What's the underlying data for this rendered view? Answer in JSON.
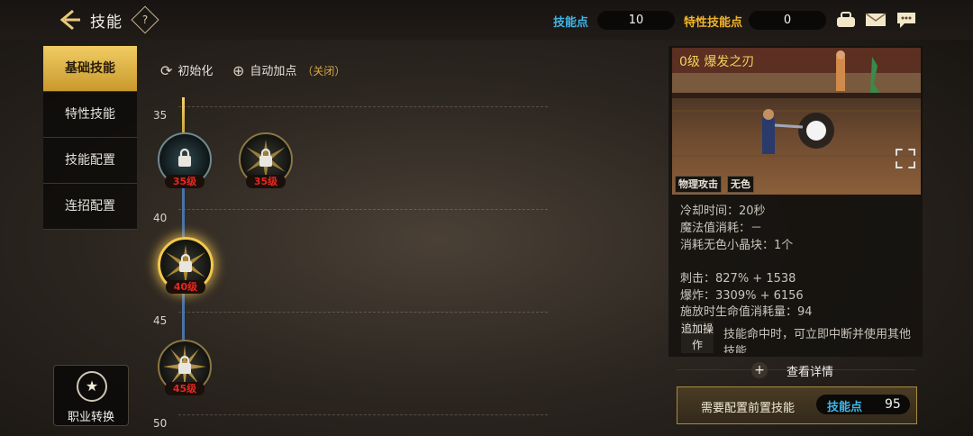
{
  "header": {
    "title": "技能",
    "help_icon": "?",
    "skill_points_label": "技能点",
    "skill_points_value": "10",
    "trait_points_label": "特性技能点",
    "trait_points_value": "0",
    "colors": {
      "skill_label": "#3fb6e8",
      "trait_label": "#f0b429"
    }
  },
  "sidebar": {
    "items": [
      {
        "label": "基础技能",
        "active": true
      },
      {
        "label": "特性技能",
        "active": false
      },
      {
        "label": "技能配置",
        "active": false
      },
      {
        "label": "连招配置",
        "active": false
      }
    ],
    "job_change_label": "职业转换"
  },
  "toolbar": {
    "reset_label": "初始化",
    "auto_label": "自动加点",
    "auto_state": "（关闭）"
  },
  "tree": {
    "levels": [
      "35",
      "40",
      "45",
      "50"
    ],
    "skills": [
      {
        "badge": "35级"
      },
      {
        "badge": "35级"
      },
      {
        "badge": "40级"
      },
      {
        "badge": "45级"
      }
    ]
  },
  "detail": {
    "name": "0级 爆发之刃",
    "tags": [
      "物理攻击",
      "无色"
    ],
    "cooldown": "冷却时间：20秒",
    "mp_cost": "魔法值消耗：－",
    "crystal_cost": "消耗无色小晶块：1个",
    "stab": "刺击：827% + 1538",
    "explode": "爆炸：3309% + 6156",
    "hp_cost": "施放时生命值消耗量：94",
    "extra_tag": "追加操作",
    "extra_text": "技能命中时，可立即中断并使用其他技能",
    "view_detail_label": "查看详情",
    "need_prereq_label": "需要配置前置技能",
    "cost_label": "技能点",
    "cost_value": "95"
  }
}
